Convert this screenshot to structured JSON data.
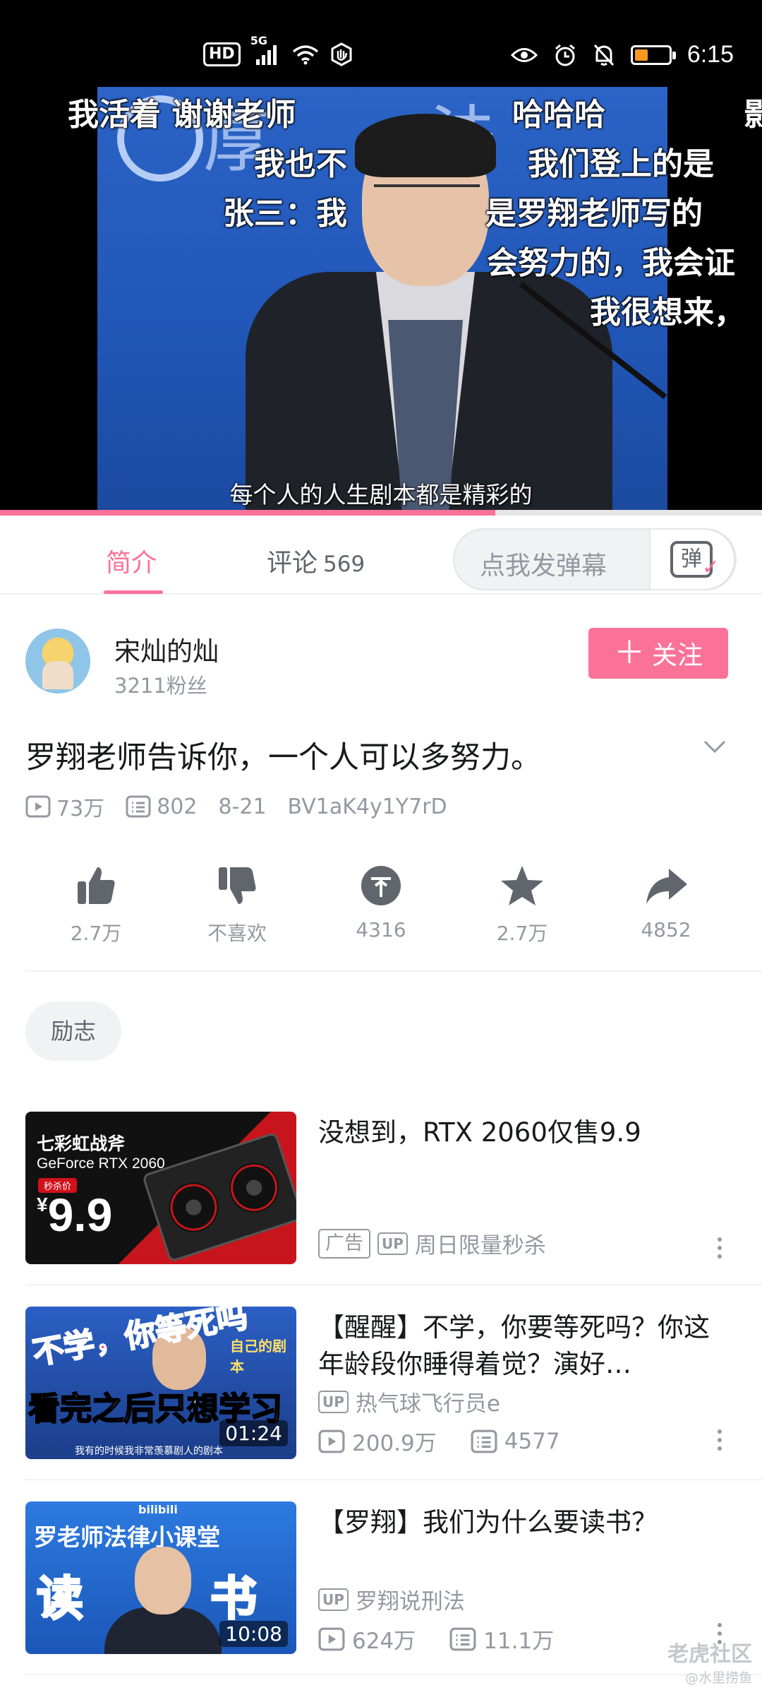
{
  "status_bar": {
    "badge_hd": "HD",
    "badge_network": "5G",
    "time": "6:15",
    "battery_percent": 22,
    "icons": [
      "hd-icon",
      "signal-icon",
      "wifi-icon",
      "hotspot-icon",
      "eye-icon",
      "alarm-icon",
      "mute-icon",
      "battery-icon"
    ]
  },
  "player": {
    "danmaku": [
      "我活着 谢谢老师",
      "哈哈哈",
      "影",
      "我也不",
      "我们登上的是",
      "张三：我",
      "是罗翔老师写的",
      "会努力的，我会证",
      "我很想来，"
    ],
    "subtitle": "每个人的人生剧本都是精彩的",
    "progress_fraction": 0.65,
    "accent_color": "#fb7299"
  },
  "tabs": {
    "intro_label": "简介",
    "comments_label": "评论",
    "comments_count": "569",
    "danmu_placeholder": "点我发弹幕",
    "danmu_icon_text": "弹"
  },
  "uploader": {
    "name": "宋灿的灿",
    "fans": "3211粉丝",
    "follow_label": "关注",
    "follow_plus": "＋"
  },
  "video": {
    "title": "罗翔老师告诉你，一个人可以多努力。",
    "views": "73万",
    "danmaku_count": "802",
    "date": "8-21",
    "bvid": "BV1aK4y1Y7rD"
  },
  "actions": [
    {
      "icon": "like-icon",
      "label": "2.7万"
    },
    {
      "icon": "dislike-icon",
      "label": "不喜欢"
    },
    {
      "icon": "coin-icon",
      "label": "4316"
    },
    {
      "icon": "favorite-icon",
      "label": "2.7万"
    },
    {
      "icon": "share-icon",
      "label": "4852"
    }
  ],
  "tag": "励志",
  "recommendations": [
    {
      "title": "没想到，RTX 2060仅售9.9",
      "ad_label": "广告",
      "up_badge": "UP",
      "up": "周日限量秒杀",
      "thumb_line1": "七彩虹战斧",
      "thumb_line2": "GeForce RTX 2060",
      "thumb_line3": "秒杀价",
      "thumb_currency": "¥",
      "thumb_price": "9.9"
    },
    {
      "title": "【醒醒】不学，你要等死吗？你这年龄段你睡得着觉？演好…",
      "up_badge": "UP",
      "up": "热气球飞行员e",
      "views": "200.9万",
      "danmaku": "4577",
      "duration": "01:24",
      "thumb_text1": "不学，你等死吗",
      "thumb_text2": "看完之后只想学习",
      "thumb_text3": "我有的时候我非常羡慕剧人的剧本",
      "thumb_text4": "自己的剧本"
    },
    {
      "title": "【罗翔】我们为什么要读书？",
      "up_badge": "UP",
      "up": "罗翔说刑法",
      "views": "624万",
      "danmaku": "11.1万",
      "duration": "10:08",
      "thumb_head": "罗老师法律小课堂",
      "thumb_char1": "读",
      "thumb_char2": "书",
      "thumb_logo": "bilibili"
    }
  ],
  "watermark": {
    "line1": "老虎社区",
    "line2": "@水里捞鱼"
  }
}
